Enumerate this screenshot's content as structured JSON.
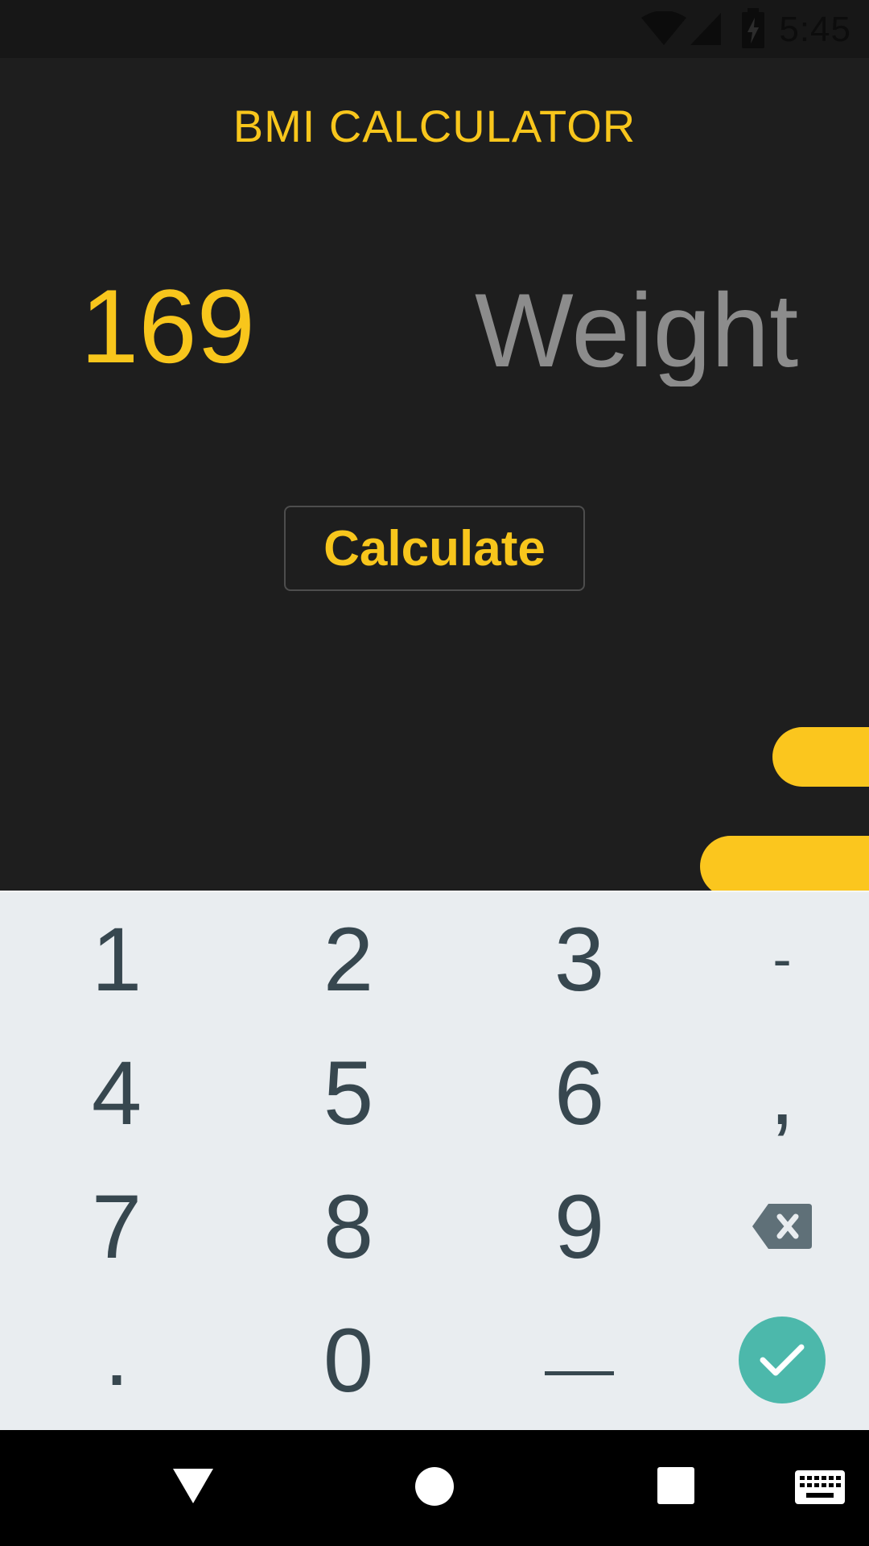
{
  "status_bar": {
    "time": "5:45",
    "icons": [
      "wifi-icon",
      "cell-signal-icon",
      "battery-charging-icon"
    ]
  },
  "app": {
    "title": "BMI CALCULATOR",
    "height_value": "169",
    "weight_placeholder": "Weight",
    "weight_value": "",
    "calculate_label": "Calculate",
    "accent_color": "#f8c61c",
    "background_color": "#1e1e1e"
  },
  "keyboard": {
    "rows": [
      [
        "1",
        "2",
        "3",
        "-"
      ],
      [
        "4",
        "5",
        "6",
        ","
      ],
      [
        "7",
        "8",
        "9",
        "backspace"
      ],
      [
        ".",
        "0",
        "space",
        "confirm"
      ]
    ],
    "labels": {
      "k1": "1",
      "k2": "2",
      "k3": "3",
      "minus": "-",
      "k4": "4",
      "k5": "5",
      "k6": "6",
      "comma": ",",
      "k7": "7",
      "k8": "8",
      "k9": "9",
      "period": ".",
      "k0": "0"
    },
    "special_keys": [
      "backspace-icon",
      "space-bar-icon",
      "checkmark-icon"
    ],
    "confirm_color": "#4cb8ab",
    "key_text_color": "#37474f",
    "background_color": "#e9edf0"
  },
  "nav_bar": {
    "buttons": [
      "back-icon",
      "home-icon",
      "recents-icon",
      "keyboard-switch-icon"
    ]
  }
}
